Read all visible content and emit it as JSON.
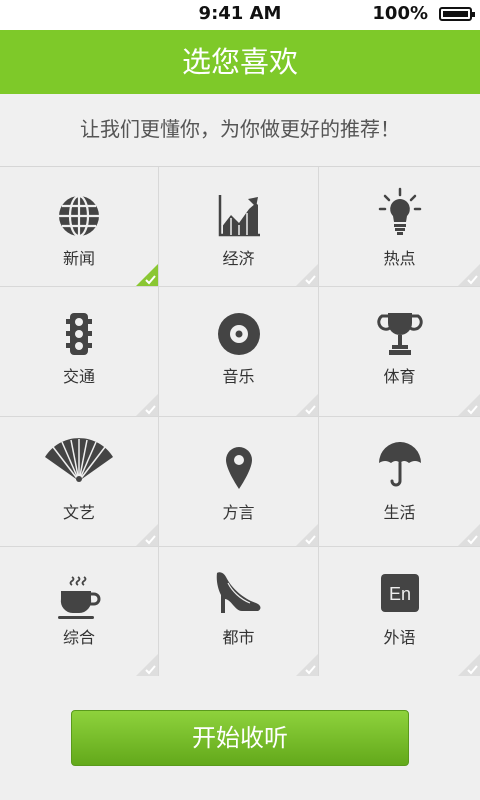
{
  "status_bar": {
    "time": "9:41 AM",
    "battery": "100%"
  },
  "header": {
    "title": "选您喜欢"
  },
  "subtitle": "让我们更懂你，为你做更好的推荐！",
  "categories": [
    {
      "label": "新闻",
      "icon": "globe-icon",
      "selected": true
    },
    {
      "label": "经济",
      "icon": "stock-chart-icon",
      "selected": false
    },
    {
      "label": "热点",
      "icon": "lightbulb-icon",
      "selected": false
    },
    {
      "label": "交通",
      "icon": "traffic-light-icon",
      "selected": false
    },
    {
      "label": "音乐",
      "icon": "vinyl-disc-icon",
      "selected": false
    },
    {
      "label": "体育",
      "icon": "trophy-icon",
      "selected": false
    },
    {
      "label": "文艺",
      "icon": "folding-fan-icon",
      "selected": false
    },
    {
      "label": "方言",
      "icon": "map-pin-icon",
      "selected": false
    },
    {
      "label": "生活",
      "icon": "umbrella-icon",
      "selected": false
    },
    {
      "label": "综合",
      "icon": "coffee-cup-icon",
      "selected": false
    },
    {
      "label": "都市",
      "icon": "high-heel-icon",
      "selected": false
    },
    {
      "label": "外语",
      "icon": "en-language-icon",
      "icon_text": "En",
      "selected": false
    }
  ],
  "start_button": {
    "label": "开始收听"
  },
  "colors": {
    "accent": "#7ec929",
    "icon": "#444444",
    "check": "#8ac733"
  }
}
